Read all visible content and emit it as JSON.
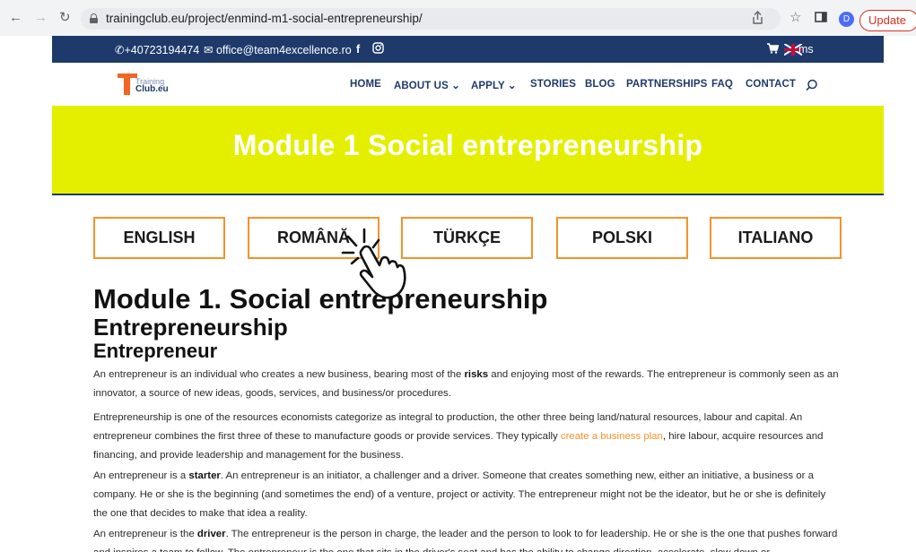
{
  "browser": {
    "url": "trainingclub.eu/project/enmind-m1-social-entrepreneurship/",
    "update_label": "Update",
    "profile_initial": "D",
    "icons": [
      "back-icon",
      "forward-icon",
      "reload-icon",
      "lock-icon",
      "share-icon",
      "star-icon",
      "sidepanel-icon"
    ]
  },
  "topbar": {
    "phone": "+40723194474",
    "email": "office@team4excellence.ro",
    "facebook": "f",
    "lang_suffix": "ms"
  },
  "header": {
    "logo_line1": "Training",
    "logo_line2": "Club.eu",
    "menu": [
      {
        "label": "HOME"
      },
      {
        "label": "ABOUT US"
      },
      {
        "label": "APPLY"
      },
      {
        "label": "STORIES"
      },
      {
        "label": "BLOG"
      },
      {
        "label": "PARTNERSHIPS"
      },
      {
        "label": "FAQ"
      },
      {
        "label": "CONTACT"
      }
    ]
  },
  "hero": {
    "title": "Module 1 Social entrepreneurship",
    "background": "#e4ef00"
  },
  "languages": [
    "ENGLISH",
    "ROMÂNĂ",
    "TÜRKÇE",
    "POLSKI",
    "ITALIANO"
  ],
  "content": {
    "h1": "Module 1. Social entrepreneurship",
    "h2": "Entrepreneurship",
    "h3": "Entrepreneur",
    "p1": {
      "a": "An entrepreneur is an individual who creates a new business, bearing most of the ",
      "b": "risks",
      "c": " and enjoying most of the rewards. The entrepreneur is commonly seen as an innovator, a source of new ideas, goods, services, and business/or procedures."
    },
    "p2": {
      "a": "Entrepreneurship is one of the resources economists categorize as integral to production, the other three being land/natural resources, labour and capital. An entrepreneur combines the first three of these to manufacture goods or provide services. They typically ",
      "link": "create a business plan",
      "c": ", hire labour, acquire resources and financing, and provide leadership and management for the business."
    },
    "p3": {
      "a": "An entrepreneur is a ",
      "b": "starter",
      "c": ". An entrepreneur is an initiator, a challenger and a driver. Someone that creates something new, either an initiative, a business or a company. He or she is the beginning (and sometimes the end) of a venture, project or activity. The entrepreneur might not be the ideator, but he or she is definitely the one that decides to make that idea a reality."
    },
    "p4": {
      "a": "An entrepreneur is the ",
      "b": "driver",
      "c": ". The entrepreneur is the person in charge, the leader and the person to look to for leadership. He or she is the one that pushes forward and inspires a team to follow. The entrepreneur is the one that sits in the driver's seat and has the ability to change direction, accelerate, slow down or"
    }
  },
  "colors": {
    "navy": "#1e3a6a",
    "accent_orange": "#f4922c",
    "hero_yellow": "#e4ef00"
  }
}
